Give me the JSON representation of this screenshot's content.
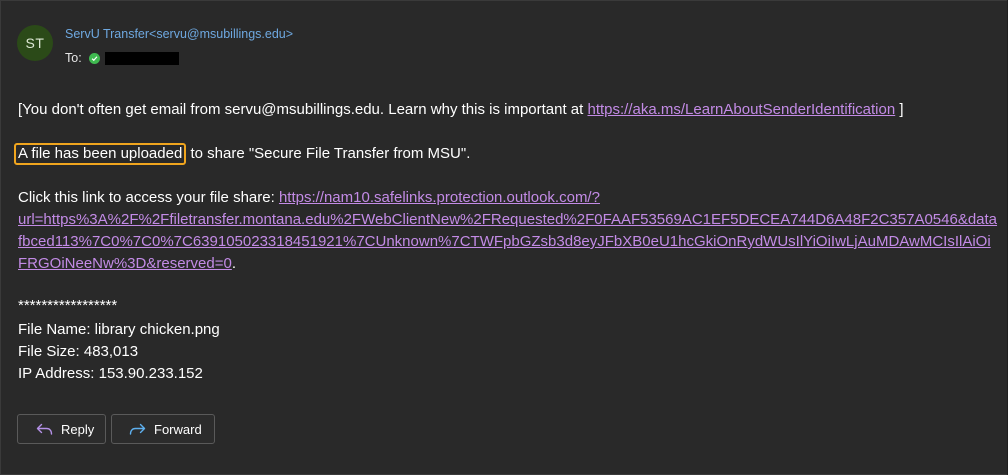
{
  "header": {
    "avatar_initials": "ST",
    "sender": "ServU Transfer<servu@msubillings.edu>",
    "to_label": "To:"
  },
  "body": {
    "notice_prefix": "[You don't often get email from servu@msubillings.edu. Learn why this is important at ",
    "notice_link": "https://aka.ms/LearnAboutSenderIdentification",
    "notice_suffix": " ]",
    "upload_highlight": "A file has been uploaded",
    "upload_rest": " to share \"Secure File Transfer from MSU\".",
    "access_prefix": "Click this link to access your file share: ",
    "link_line1": "https://nam10.safelinks.protection.outlook.com/?",
    "link_line2": "url=https%3A%2F%2Ffiletransfer.montana.edu%2FWebClientNew%2FRequested%2F0FAAF53569AC1EF5DECEA744D6A48F2C357A0546&data",
    "link_line3": "fbced113%7C0%7C0%7C639105023318451921%7CUnknown%7CTWFpbGZsb3d8eyJFbXB0eU1hcGkiOnRydWUsIlYiOiIwLjAuMDAwMCIsIlAiOi",
    "link_line4": "FRGOiNeeNw%3D&reserved=0",
    "link_end": ".",
    "stars": "*****************",
    "file_name": "File Name: library chicken.png",
    "file_size": "File Size: 483,013",
    "ip_address": "IP Address: 153.90.233.152"
  },
  "actions": {
    "reply": "Reply",
    "forward": "Forward",
    "reply_icon": "reply-arrow-icon",
    "forward_icon": "forward-arrow-icon"
  },
  "colors": {
    "link": "#c38be6",
    "sender": "#6ea8e0",
    "highlight": "#f0a51e"
  }
}
